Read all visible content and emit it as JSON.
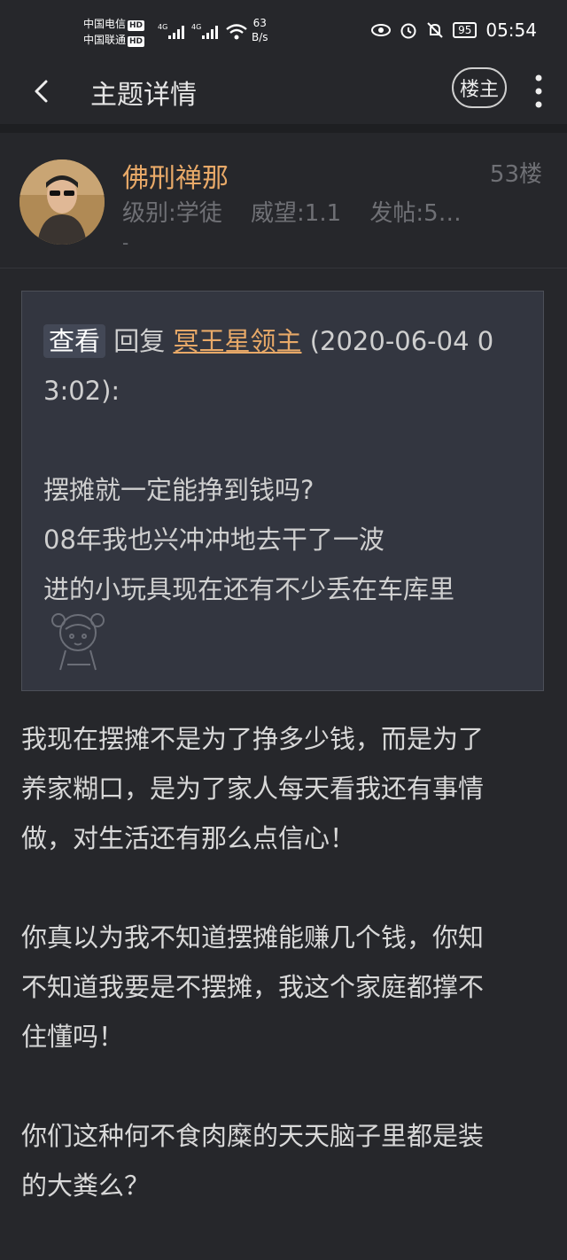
{
  "status_bar": {
    "carrier1": "中国电信",
    "carrier2": "中国联通",
    "hd": "HD",
    "net_type": "4G",
    "net_speed_value": "63",
    "net_speed_unit": "B/s",
    "battery": "95",
    "time": "05:54"
  },
  "header": {
    "title": "主题详情",
    "louzhu_label": "楼主"
  },
  "post": {
    "author": "佛刑禅那",
    "floor": "53楼",
    "level": "级别:学徒",
    "prestige": "威望:1.1",
    "posts": "发帖:5…",
    "dash": "-",
    "quote": {
      "view_label": "查看",
      "reply_label": "回复",
      "reply_user": "冥王星领主",
      "reply_time_part1": "(2020-06-04 0",
      "reply_time_part2": "3:02):",
      "lines": [
        "摆摊就一定能挣到钱吗?",
        "08年我也兴冲冲地去干了一波",
        "进的小玩具现在还有不少丢在车库里"
      ]
    },
    "body": {
      "p1_l1": "我现在摆摊不是为了挣多少钱，而是为了",
      "p1_l2": "养家糊口，是为了家人每天看我还有事情",
      "p1_l3": "做，对生活还有那么点信心！",
      "p2_l1": "你真以为我不知道摆摊能赚几个钱，你知",
      "p2_l2": "不知道我要是不摆摊，我这个家庭都撑不",
      "p2_l3": "住懂吗！",
      "p3_l1": "你们这种何不食肉糜的天天脑子里都是装",
      "p3_l2": "的大粪么？"
    }
  },
  "colors": {
    "background": "#26272b",
    "accent": "#e8a968",
    "muted": "#6f7075",
    "quote_bg": "#333640"
  },
  "icons": [
    "back-arrow-icon",
    "more-vertical-icon",
    "eye-icon",
    "alarm-icon",
    "bell-off-icon",
    "wifi-icon",
    "signal-icon",
    "sticker-icon"
  ]
}
